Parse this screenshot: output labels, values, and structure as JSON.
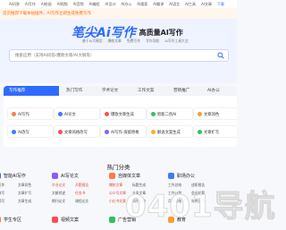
{
  "topnav": {
    "links": [
      "AI问答",
      "AI写作",
      "AI绘画",
      "AI视频",
      "AI音频",
      "AI编程",
      "AI设计",
      "AI办公",
      "AI搜索",
      "AI翻译",
      "AI语言",
      "AI工具",
      "AI文章",
      "下载"
    ]
  },
  "notice": "首页推荐下载本站插件，AI写作立即生成免费写作",
  "hero": {
    "logo": "笔尖Ai写作",
    "slogan": "高质量AI写作",
    "sublinks": [
      "基于Ai大模型",
      "爆款文章",
      "免费写作",
      "写作导航",
      "Ai写作工具大全"
    ]
  },
  "search": {
    "placeholder": "搜索应用（支持AI问答/爆款文章/AI大纲等）"
  },
  "tabs": [
    "写作推荐",
    "热门写作",
    "学术论文",
    "工作文案",
    "营销推广",
    "AI办公"
  ],
  "tools": [
    {
      "label": "AI写作",
      "color": "#ff7a45"
    },
    {
      "label": "AI论文",
      "color": "#3c7bff"
    },
    {
      "label": "爆款文章生成",
      "color": "#ff4d4f"
    },
    {
      "label": "智能二创AI",
      "color": "#2fc25b"
    },
    {
      "label": "文章润色",
      "color": "#ff9c2e"
    },
    {
      "label": "朋友圈文案",
      "color": "#ff6a00"
    },
    {
      "label": "AI改写",
      "color": "#3c7bff"
    },
    {
      "label": "文章风格改写",
      "color": "#ff4d4f"
    },
    {
      "label": "AI写作-保留原格",
      "color": "#8a5cff"
    },
    {
      "label": "解说文案生成",
      "color": "#ffb020"
    },
    {
      "label": "文章扩写",
      "color": "#2fc25b"
    },
    {
      "label": "文章洗稿去重",
      "color": "#ff6a00"
    }
  ],
  "section_title": "热门分类",
  "categories": [
    {
      "title": "智能AI写作",
      "color": "#2f6bff",
      "items": [
        "AI写作",
        "文章润色",
        "AI改写",
        "文章扩写",
        "AI续写",
        "文章生成"
      ],
      "red": [],
      "more": "学生专区",
      "more_color": "#ff7a45"
    },
    {
      "title": "AI写论文",
      "color": "#8a5cff",
      "items": [
        "毕业论文",
        "开题报告",
        "文献综述",
        "任务书",
        "期刊论文",
        "课程论文"
      ],
      "red": [
        0,
        1,
        3
      ],
      "more": "视频文案",
      "more_color": "#ff4d4f"
    },
    {
      "title": "自媒体文章",
      "color": "#ff7a45",
      "items": [
        "爆款文章",
        "标题生成",
        "公众号文章",
        "头条文章",
        "小红书文案",
        "知乎问答"
      ],
      "red": [
        0,
        2,
        4
      ],
      "more": "广告营销",
      "more_color": "#2fc25b"
    },
    {
      "title": "职场办公",
      "color": "#3c7bff",
      "items": [
        "工作总结",
        "述职报告",
        "工作计划",
        "会议纪要",
        "月度总结",
        "年终总结"
      ],
      "red": [],
      "more": "教育",
      "more_color": "#ff9c2e"
    }
  ],
  "watermark": "0401导航"
}
